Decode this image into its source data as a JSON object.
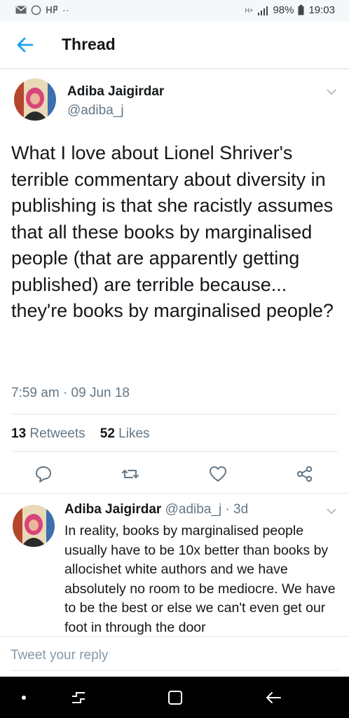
{
  "status_bar": {
    "network": "H+",
    "battery": "98%",
    "time": "19:03",
    "icons": [
      "mail-icon",
      "whatsapp-icon",
      "notification-icon",
      "more-dots-icon",
      "signal-icon",
      "battery-icon"
    ]
  },
  "header": {
    "title": "Thread",
    "back_icon": "back-arrow-icon"
  },
  "tweet": {
    "author_name": "Adiba Jaigirdar",
    "handle": "@adiba_j",
    "text": "What I love about Lionel Shriver's terrible commentary about diversity in publishing is that she racistly assumes that all these books by marginalised people (that are apparently getting published) are terrible because... they're books by marginalised people?",
    "time": "7:59 am · 09 Jun 18",
    "retweets_count": "13",
    "retweets_label": "Retweets",
    "likes_count": "52",
    "likes_label": "Likes",
    "actions": [
      "reply-icon",
      "retweet-icon",
      "like-icon",
      "share-icon"
    ]
  },
  "reply": {
    "author_name": "Adiba Jaigirdar",
    "handle_time": "@adiba_j · 3d",
    "text": "In reality, books by marginalised people usually have to be 10x better than books by allocishet white authors and we have absolutely no room to be mediocre. We have to be the best or else we can't even get our foot in through the door"
  },
  "compose": {
    "placeholder": "Tweet your reply"
  },
  "navbar": {
    "icons": [
      "dot-icon",
      "recent-apps-icon",
      "home-icon",
      "back-icon"
    ]
  },
  "colors": {
    "accent": "#1da1f2",
    "text_primary": "#14171a",
    "text_secondary": "#657786",
    "divider": "#e1e8ed"
  }
}
